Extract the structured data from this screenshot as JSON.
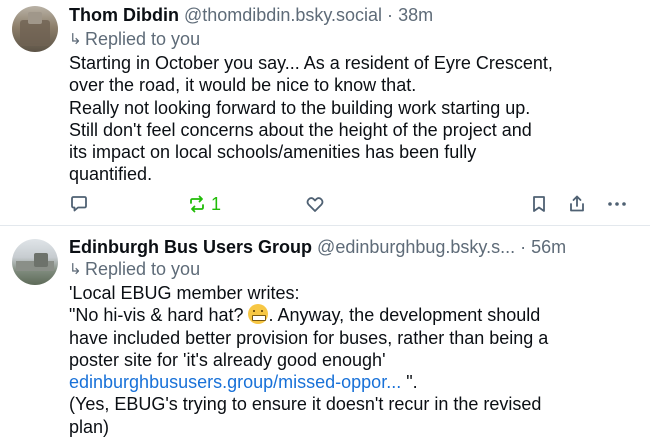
{
  "posts": [
    {
      "author_name": "Thom Dibdin",
      "handle": "@thomdibdin.bsky.social",
      "separator": "·",
      "time": "38m",
      "reply_label": "Replied to you",
      "lines": [
        "Starting in October you say... As a resident of Eyre Crescent,",
        "over the road, it would be nice to know that.",
        "Really not looking forward to the building work starting up.",
        "Still don't feel concerns about the height of the project and",
        "its impact on local schools/amenities has been fully",
        "quantified."
      ],
      "actions": {
        "repost_count": "1",
        "icons": [
          "reply-icon",
          "repost-icon",
          "like-icon",
          "bookmark-icon",
          "share-icon",
          "more-icon"
        ]
      }
    },
    {
      "author_name": "Edinburgh Bus Users Group",
      "handle": "@edinburghbug.bsky.s...",
      "separator": "·",
      "time": "56m",
      "reply_label": "Replied to you",
      "line1": "'Local EBUG member writes:",
      "line2_before_emoji": "\"No hi-vis & hard hat? ",
      "emoji": "grimacing-face-emoji",
      "line2_after_emoji": ". Anyway, the development should",
      "line3": "have included better provision for buses, rather than being a",
      "line4": "poster site for 'it's already good enough'",
      "link_text": "edinburghbususers.group/missed-oppor...",
      "link_suffix": " \".",
      "line6": "(Yes, EBUG's trying to ensure it doesn't recur in the revised",
      "line7": "plan)"
    }
  ],
  "colors": {
    "text": "#0b0f14",
    "muted": "#5e6b78",
    "link": "#1871d8",
    "repost_active": "#20bc07",
    "icon": "#4f6173",
    "divider": "#e3e8ed"
  }
}
